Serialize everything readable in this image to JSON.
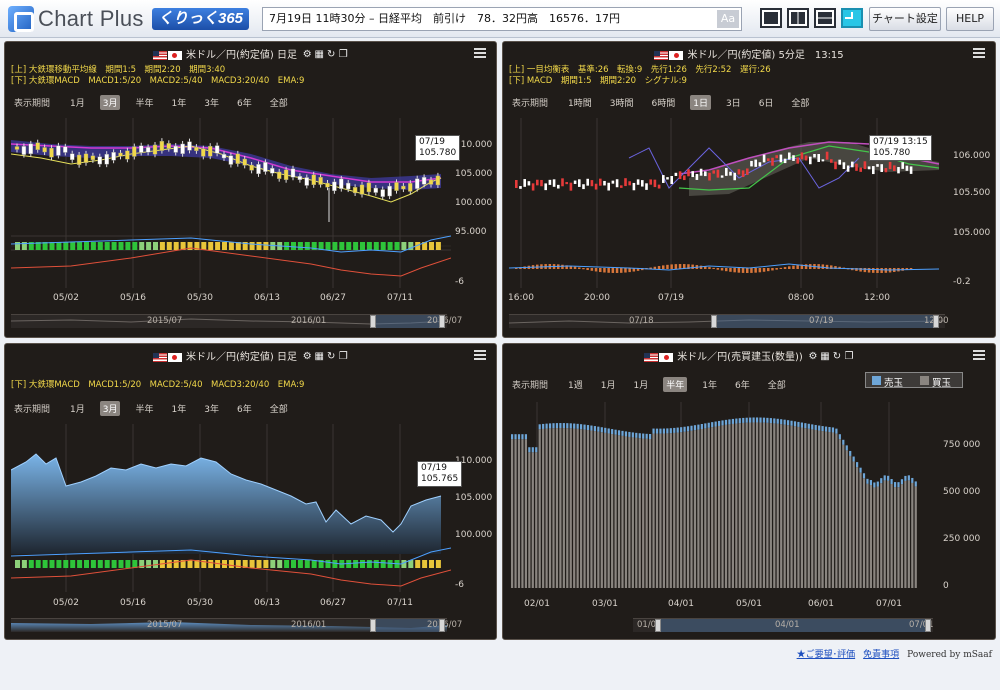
{
  "header": {
    "logo_text": "Chart Plus",
    "logo_badge": "くりっく365",
    "ticker": "7月19日 11時30分 – 日経平均　前引け　78．32円高　16576．17円",
    "font_toggle": "Aa",
    "chart_settings": "チャート設定",
    "help": "HELP"
  },
  "panels": {
    "p1": {
      "title": "米ドル／円(約定値) 日足",
      "info1": "[上] 大鉄環移動平均線　期間1:5　期間2:20　期間3:40",
      "info2": "[下] 大鉄環MACD　MACD1:5/20　MACD2:5/40　MACD3:20/40　EMA:9",
      "period_label": "表示期間",
      "periods": [
        "1月",
        "3月",
        "半年",
        "1年",
        "3年",
        "6年",
        "全部"
      ],
      "selected": "3月",
      "y_ticks": [
        "110.000",
        "105.000",
        "100.000",
        "95.000"
      ],
      "y_sub": "-6",
      "x_ticks": [
        "05/02",
        "05/16",
        "05/30",
        "06/13",
        "06/27",
        "07/11"
      ],
      "nav_labels": [
        "2015/07",
        "2016/01",
        "2016/07"
      ],
      "tip_date": "07/19",
      "tip_value": "105.780"
    },
    "p2": {
      "title": "米ドル／円(約定値) 5分足　13:15",
      "info1": "[上] 一目均衡表　基準:26　転換:9　先行1:26　先行2:52　遅行:26",
      "info2": "[下] MACD　期間1:5　期間2:20　シグナル:9",
      "period_label": "表示期間",
      "periods": [
        "1時間",
        "3時間",
        "6時間",
        "1日",
        "3日",
        "6日",
        "全部"
      ],
      "selected": "1日",
      "y_ticks": [
        "106.000",
        "105.500",
        "105.000"
      ],
      "y_sub": "-0.2",
      "x_ticks": [
        "16:00",
        "20:00",
        "07/19",
        "08:00",
        "12:00"
      ],
      "nav_labels": [
        "07/18",
        "07/19",
        "12:00"
      ],
      "tip_date": "07/19 13:15",
      "tip_value": "105.780"
    },
    "p3": {
      "title": "米ドル／円(約定値) 日足",
      "info2": "[下] 大鉄環MACD　MACD1:5/20　MACD2:5/40　MACD3:20/40　EMA:9",
      "period_label": "表示期間",
      "periods": [
        "1月",
        "3月",
        "半年",
        "1年",
        "3年",
        "6年",
        "全部"
      ],
      "selected": "3月",
      "y_ticks": [
        "110.000",
        "105.000",
        "100.000"
      ],
      "y_sub": "-6",
      "x_ticks": [
        "05/02",
        "05/16",
        "05/30",
        "06/13",
        "06/27",
        "07/11"
      ],
      "nav_labels": [
        "2015/07",
        "2016/01",
        "2016/07"
      ],
      "tip_date": "07/19",
      "tip_value": "105.765"
    },
    "p4": {
      "title": "米ドル／円(売買建玉(数量))",
      "period_label": "表示期間",
      "periods": [
        "1週",
        "1月",
        "1月",
        "半年",
        "1年",
        "6年",
        "全部"
      ],
      "selected": "半年",
      "legend": [
        "売玉",
        "買玉"
      ],
      "y_ticks": [
        "750 000",
        "500 000",
        "250 000",
        "0"
      ],
      "x_ticks": [
        "02/01",
        "03/01",
        "04/01",
        "05/01",
        "06/01",
        "07/01"
      ],
      "nav_labels": [
        "01/01",
        "04/01",
        "07/01"
      ]
    }
  },
  "footer": {
    "request": "★ご要望･評価",
    "disclaimer": "免責事項",
    "powered": "Powered by mSaaf"
  },
  "colors": {
    "panel_bg": "#201c19",
    "accent_blue": "#28c6e6",
    "area_blue": "#6ea6d8",
    "info_yellow": "#f2d94a"
  }
}
